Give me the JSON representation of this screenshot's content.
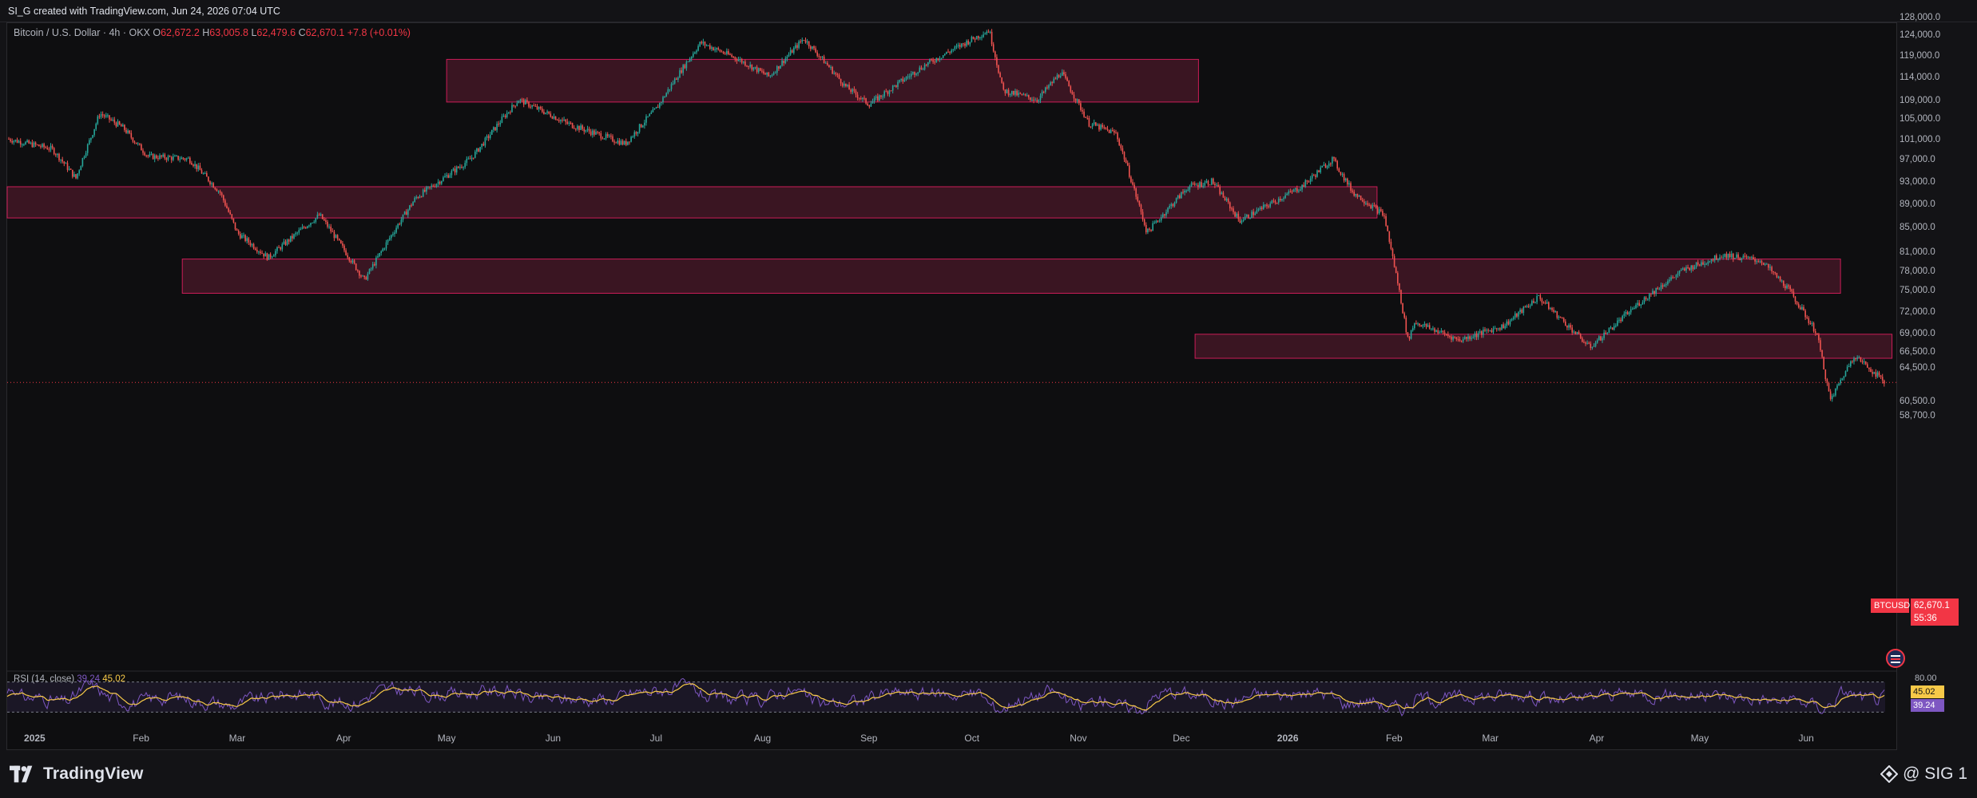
{
  "header": {
    "credit": "SI_G created with TradingView.com, Jun 24, 2026 07:04 UTC"
  },
  "legend": {
    "symbol": "Bitcoin / U.S. Dollar · 4h · OKX",
    "o_key": "O",
    "o": "62,672.2",
    "h_key": "H",
    "h": "63,005.8",
    "l_key": "L",
    "l": "62,479.6",
    "c_key": "C",
    "c": "62,670.1",
    "change": "+7.8 (+0.01%)"
  },
  "rsi_legend": {
    "label": "RSI (14, close)",
    "value1": "39.24",
    "value2": "45.02"
  },
  "price_tags": {
    "symbol": "BTCUSD",
    "last": "62,670.1",
    "countdown": "55:36"
  },
  "rsi_tags": {
    "a": "45.02",
    "b": "39.24",
    "top": "80.00"
  },
  "footer": {
    "brand": "TradingView",
    "badge": "@ SIG 1"
  },
  "colors": {
    "up": "#26a69a",
    "down": "#ef5350",
    "zone_fill": "#4a1828",
    "zone_stroke": "#e91e63",
    "rsi": "#7e57c2",
    "rsi_ma": "#f7c948",
    "price_line": "#f23645"
  },
  "chart_data": {
    "type": "candlestick",
    "title": "Bitcoin / U.S. Dollar · 4h · OKX",
    "y_ticks": [
      128000,
      124000,
      119000,
      114000,
      109000,
      105000,
      101000,
      97000,
      93000,
      89000,
      85000,
      81000,
      78000,
      75000,
      72000,
      69000,
      66500,
      64500,
      60500,
      58700
    ],
    "y_tick_labels": [
      "128,000.0",
      "124,000.0",
      "119,000.0",
      "114,000.0",
      "109,000.0",
      "105,000.0",
      "101,000.0",
      "97,000.0",
      "93,000.0",
      "89,000.0",
      "85,000.0",
      "81,000.0",
      "78,000.0",
      "75,000.0",
      "72,000.0",
      "69,000.0",
      "66,500.0",
      "64,500.0",
      "60,500.0",
      "58,700.0"
    ],
    "x_labels": [
      "2025",
      "Feb",
      "Mar",
      "Apr",
      "May",
      "Jun",
      "Jul",
      "Aug",
      "Sep",
      "Oct",
      "Nov",
      "Dec",
      "2026",
      "Feb",
      "Mar",
      "Apr",
      "May",
      "Jun"
    ],
    "x_label_dates": [
      "2025-01-01",
      "2025-02-01",
      "2025-03-01",
      "2025-04-01",
      "2025-05-01",
      "2025-06-01",
      "2025-07-01",
      "2025-08-01",
      "2025-09-01",
      "2025-10-01",
      "2025-11-01",
      "2025-12-01",
      "2026-01-01",
      "2026-02-01",
      "2026-03-01",
      "2026-04-01",
      "2026-05-01",
      "2026-06-01"
    ],
    "x_range": [
      "2024-12-24",
      "2026-06-24"
    ],
    "price_path": [
      [
        "2024-12-24",
        101000
      ],
      [
        "2025-01-06",
        99000
      ],
      [
        "2025-01-13",
        93500
      ],
      [
        "2025-01-20",
        106000
      ],
      [
        "2025-01-27",
        103000
      ],
      [
        "2025-02-03",
        97500
      ],
      [
        "2025-02-15",
        97000
      ],
      [
        "2025-02-24",
        91000
      ],
      [
        "2025-03-01",
        84000
      ],
      [
        "2025-03-10",
        80000
      ],
      [
        "2025-03-25",
        87000
      ],
      [
        "2025-04-07",
        76500
      ],
      [
        "2025-04-22",
        90000
      ],
      [
        "2025-05-08",
        97000
      ],
      [
        "2025-05-22",
        109000
      ],
      [
        "2025-06-05",
        104000
      ],
      [
        "2025-06-22",
        100000
      ],
      [
        "2025-07-01",
        107000
      ],
      [
        "2025-07-14",
        122000
      ],
      [
        "2025-07-25",
        118000
      ],
      [
        "2025-08-03",
        114000
      ],
      [
        "2025-08-13",
        123000
      ],
      [
        "2025-08-25",
        112000
      ],
      [
        "2025-09-01",
        108000
      ],
      [
        "2025-09-18",
        117000
      ],
      [
        "2025-10-06",
        125000
      ],
      [
        "2025-10-10",
        111000
      ],
      [
        "2025-10-20",
        109000
      ],
      [
        "2025-10-27",
        115000
      ],
      [
        "2025-11-04",
        104000
      ],
      [
        "2025-11-12",
        102000
      ],
      [
        "2025-11-21",
        84000
      ],
      [
        "2025-12-03",
        92000
      ],
      [
        "2025-12-10",
        93000
      ],
      [
        "2025-12-18",
        86000
      ],
      [
        "2026-01-05",
        92000
      ],
      [
        "2026-01-14",
        97000
      ],
      [
        "2026-01-20",
        91000
      ],
      [
        "2026-01-29",
        87000
      ],
      [
        "2026-02-05",
        68000
      ],
      [
        "2026-02-07",
        70500
      ],
      [
        "2026-02-20",
        68000
      ],
      [
        "2026-03-05",
        70000
      ],
      [
        "2026-03-15",
        74000
      ],
      [
        "2026-03-30",
        67000
      ],
      [
        "2026-04-13",
        73000
      ],
      [
        "2026-04-26",
        78000
      ],
      [
        "2026-05-08",
        80500
      ],
      [
        "2026-05-19",
        79500
      ],
      [
        "2026-05-27",
        75000
      ],
      [
        "2026-06-04",
        69000
      ],
      [
        "2026-06-08",
        60500
      ],
      [
        "2026-06-15",
        66000
      ],
      [
        "2026-06-24",
        62670
      ]
    ],
    "zones": [
      {
        "from": "2025-05-01",
        "to": "2025-12-06",
        "low": 108500,
        "high": 118000
      },
      {
        "from": "2024-12-24",
        "to": "2026-01-27",
        "low": 86500,
        "high": 92000
      },
      {
        "from": "2025-02-13",
        "to": "2026-06-11",
        "low": 74500,
        "high": 79800
      },
      {
        "from": "2025-12-05",
        "to": "2026-06-26",
        "low": 65600,
        "high": 68800
      }
    ],
    "last_price": 62670.1,
    "rsi": {
      "label": "RSI (14, close)",
      "value": 39.24,
      "ma": 45.02,
      "upper": 80,
      "lower": 20
    }
  }
}
